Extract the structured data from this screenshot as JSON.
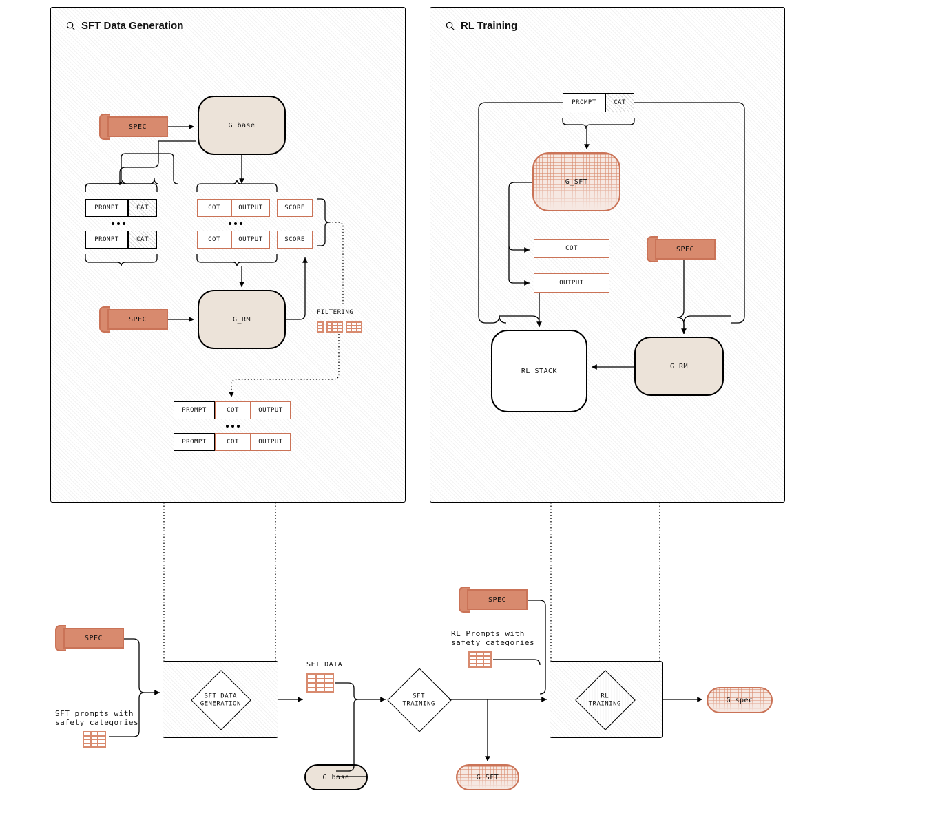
{
  "panel_left_title": "SFT Data Generation",
  "panel_right_title": "RL Training",
  "labels": {
    "spec": "SPEC",
    "g_base": "G_base",
    "g_rm": "G_RM",
    "g_sft": "G_SFT",
    "g_spec": "G_spec",
    "prompt": "PROMPT",
    "cat": "CAT",
    "cot": "COT",
    "output": "OUTPUT",
    "score": "SCORE",
    "filtering": "FILTERING",
    "rl_stack": "RL STACK",
    "sft_data_generation": "SFT DATA\nGENERATION",
    "sft_training": "SFT\nTRAINING",
    "rl_training": "RL\nTRAINING",
    "sft_data": "SFT DATA",
    "sft_prompts": "SFT prompts with\nsafety categories",
    "rl_prompts": "RL Prompts with\nsafety categories"
  }
}
